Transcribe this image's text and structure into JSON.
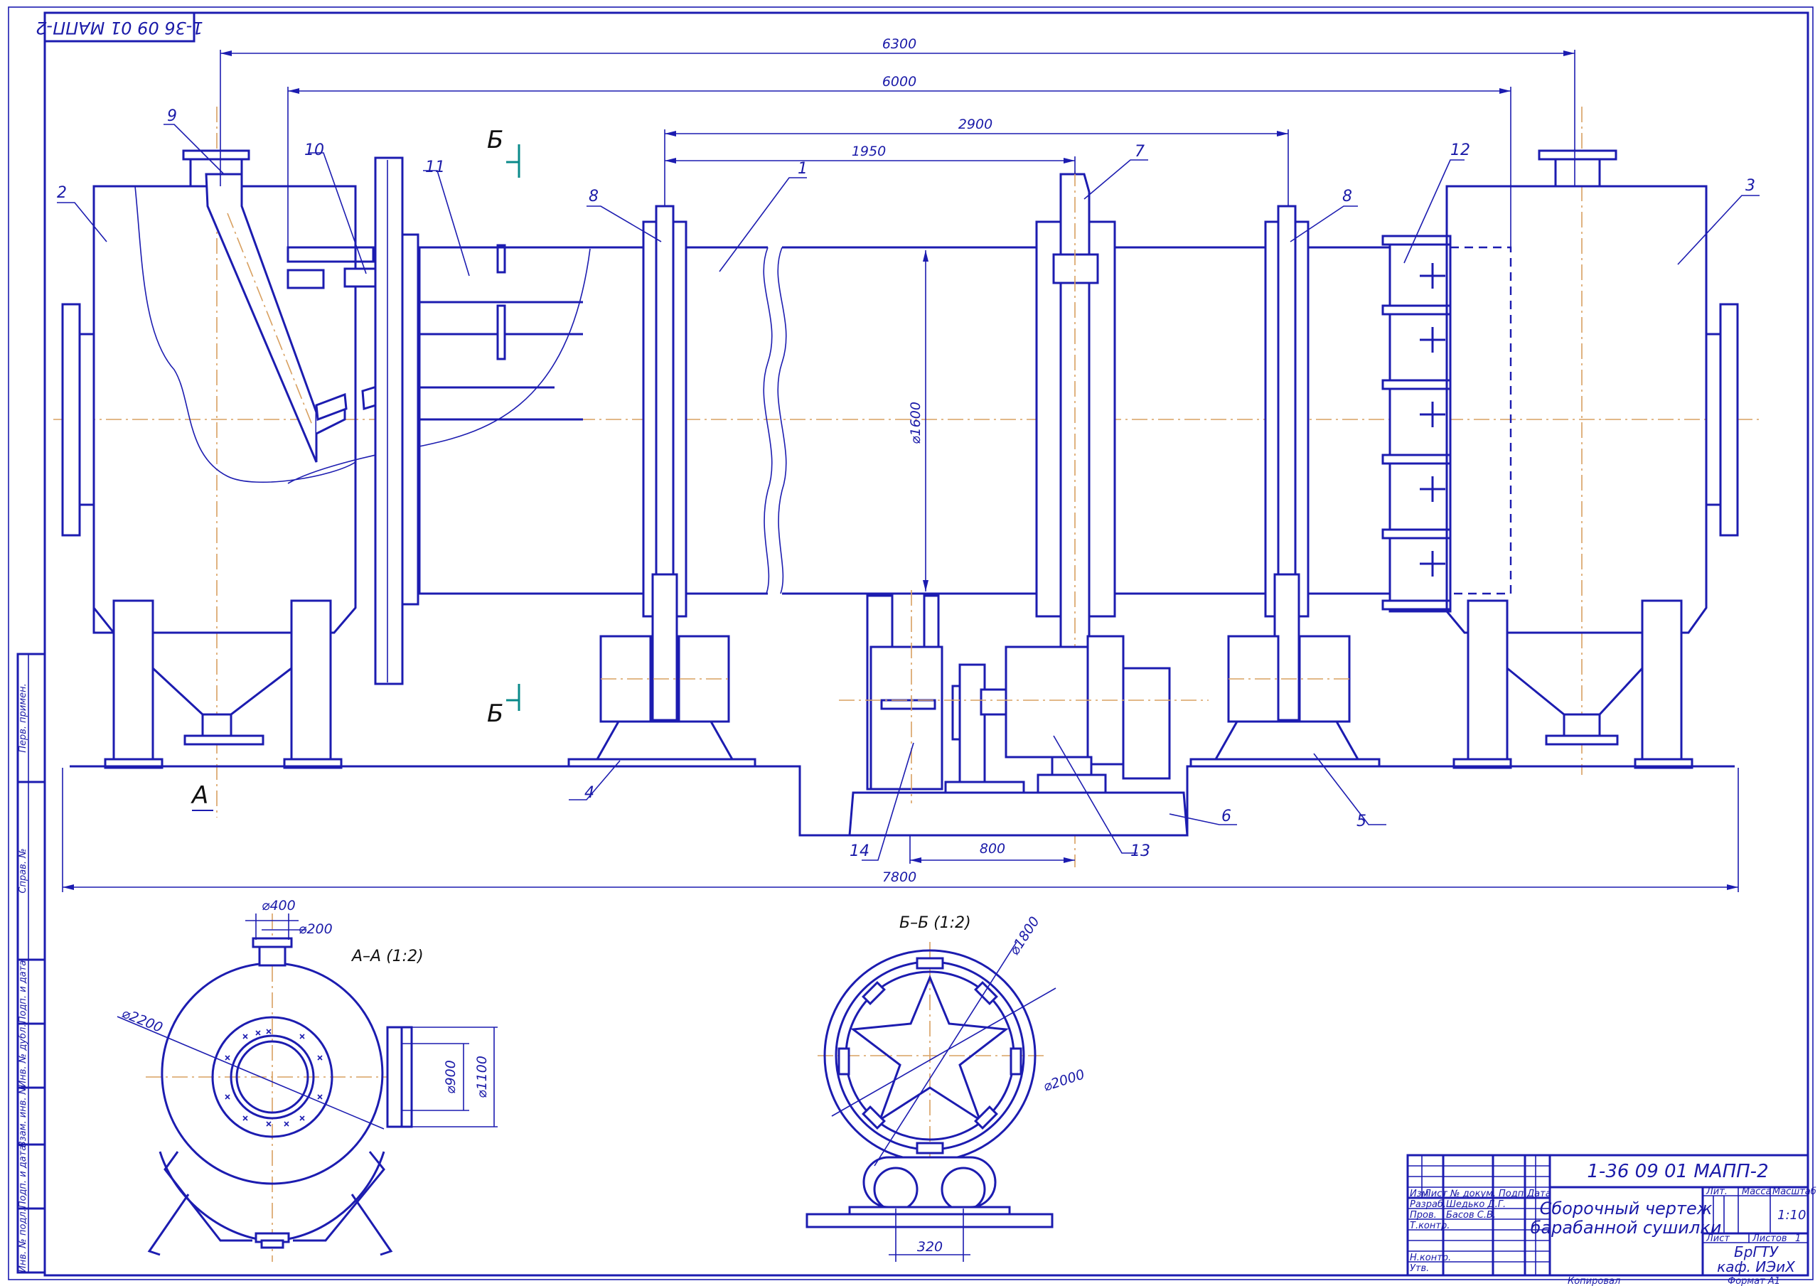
{
  "stamp": {
    "designation_top": "1-36 09 01 МАПП-2"
  },
  "dimensions": {
    "d6300": "6300",
    "d6000": "6000",
    "d2900": "2900",
    "d1950": "1950",
    "d1600": "⌀1600",
    "d800": "800",
    "d7800": "7800",
    "d400": "⌀400",
    "d200": "⌀200",
    "d2200": "⌀2200",
    "d900": "⌀900",
    "d1100": "⌀1100",
    "d1800": "⌀1800",
    "d2000": "⌀2000",
    "d320": "320"
  },
  "positions": [
    "1",
    "2",
    "3",
    "4",
    "5",
    "6",
    "7",
    "8",
    "8",
    "9",
    "10",
    "11",
    "12",
    "13",
    "14"
  ],
  "section_marks": {
    "b_top": "Б",
    "b_bottom": "Б",
    "a": "А"
  },
  "sections": {
    "aa": "А–А (1:2)",
    "bb": "Б–Б (1:2)"
  },
  "side_strip": {
    "perv_primen": "Перв. примен.",
    "sprav_no": "Справ. №",
    "podp_data1": "Подп. и дата",
    "inv_dubl": "Инв. № дубл.",
    "vzam_inv": "Взам. инв. №",
    "podp_data2": "Подп. и дата",
    "inv_podl": "Инв. № подл."
  },
  "title_block": {
    "designation": "1-36 09 01 МАПП-2",
    "title_line1": "Сборочный чертеж",
    "title_line2": "барабанной сушилки",
    "h_izm": "Изм",
    "h_list": "Лист",
    "h_ndokum": "№ докум.",
    "h_podp": "Подп.",
    "h_data": "Дата",
    "r_razrab": "Разраб.",
    "n_razrab": "Шедько Д.Г.",
    "r_prov": "Пров.",
    "n_prov": "Басов С.В.",
    "r_tkontr": "Т.контр.",
    "r_nkontr": "Н.контр.",
    "r_utv": "Утв.",
    "h_lit": "Лит.",
    "h_massa": "Масса",
    "h_masshtab": "Масштаб",
    "v_masshtab": "1:10",
    "h_list2": "Лист",
    "h_listov": "Листов",
    "v_listov": "1",
    "org_line1": "БрГТУ",
    "org_line2": "каф. ИЭиХ",
    "kopiroval": "Копировал",
    "format": "Формат  А1"
  }
}
